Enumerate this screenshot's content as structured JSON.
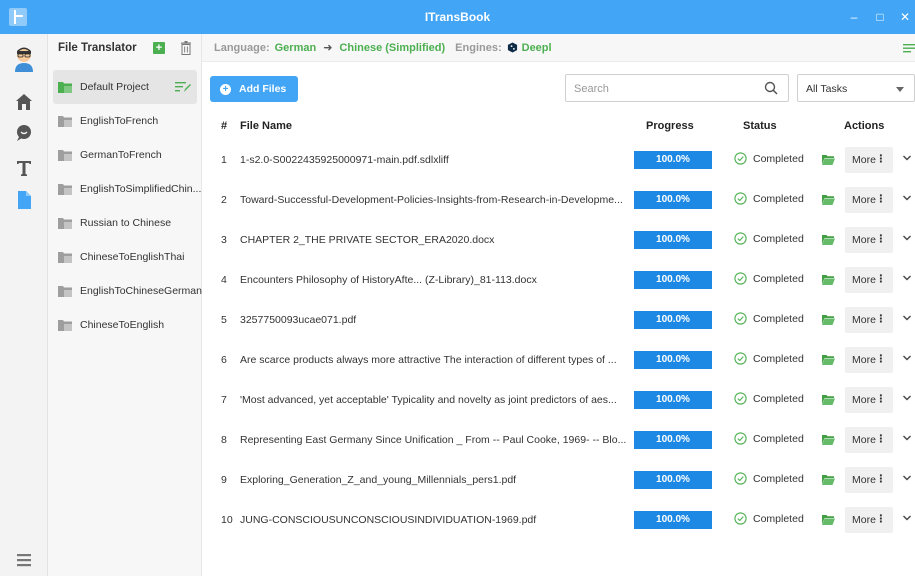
{
  "window": {
    "title": "ITransBook",
    "controls": [
      "minimize",
      "maximize",
      "close"
    ]
  },
  "colors": {
    "accent": "#42a5f5",
    "progress": "#1e88e5",
    "success": "#4caf50"
  },
  "rail": {
    "items": [
      "home-icon",
      "chat-icon",
      "text-icon",
      "file-icon"
    ],
    "active": "file-icon",
    "bottom": "list-icon"
  },
  "sidebar": {
    "title": "File Translator",
    "projects": [
      {
        "label": "Default Project",
        "active": true
      },
      {
        "label": "EnglishToFrench"
      },
      {
        "label": "GermanToFrench"
      },
      {
        "label": "EnglishToSimplifiedChin..."
      },
      {
        "label": "Russian to Chinese"
      },
      {
        "label": "ChineseToEnglishThai"
      },
      {
        "label": "EnglishToChineseGerman"
      },
      {
        "label": "ChineseToEnglish"
      }
    ]
  },
  "langbar": {
    "language_label": "Language:",
    "source": "German",
    "target": "Chinese (Simplified)",
    "engines_label": "Engines:",
    "engine": "Deepl"
  },
  "toolbar": {
    "add_files": "Add Files",
    "search_placeholder": "Search",
    "task_filter": "All Tasks"
  },
  "table": {
    "headers": {
      "num": "#",
      "name": "File Name",
      "progress": "Progress",
      "status": "Status",
      "actions": "Actions"
    },
    "more_label": "More",
    "rows": [
      {
        "num": "1",
        "name": "1-s2.0-S0022435925000971-main.pdf.sdlxliff",
        "progress": "100.0%",
        "progress_value": 1.0,
        "status": "Completed"
      },
      {
        "num": "2",
        "name": "Toward-Successful-Development-Policies-Insights-from-Research-in-Developme...",
        "progress": "100.0%",
        "progress_value": 1.0,
        "status": "Completed"
      },
      {
        "num": "3",
        "name": "CHAPTER 2_THE PRIVATE SECTOR_ERA2020.docx",
        "progress": "100.0%",
        "progress_value": 1.0,
        "status": "Completed"
      },
      {
        "num": "4",
        "name": "Encounters Philosophy of HistoryAfte... (Z-Library)_81-113.docx",
        "progress": "100.0%",
        "progress_value": 1.0,
        "status": "Completed"
      },
      {
        "num": "5",
        "name": "3257750093ucae071.pdf",
        "progress": "100.0%",
        "progress_value": 1.0,
        "status": "Completed"
      },
      {
        "num": "6",
        "name": "Are scarce products always more attractive The interaction of different types of ...",
        "progress": "100.0%",
        "progress_value": 1.0,
        "status": "Completed"
      },
      {
        "num": "7",
        "name": "'Most advanced, yet acceptable' Typicality and novelty as joint predictors of aes...",
        "progress": "100.0%",
        "progress_value": 1.0,
        "status": "Completed"
      },
      {
        "num": "8",
        "name": "Representing East Germany Since Unification _ From -- Paul Cooke, 1969- -- Blo...",
        "progress": "100.0%",
        "progress_value": 1.0,
        "status": "Completed"
      },
      {
        "num": "9",
        "name": "Exploring_Generation_Z_and_young_Millennials_pers1.pdf",
        "progress": "100.0%",
        "progress_value": 1.0,
        "status": "Completed"
      },
      {
        "num": "10",
        "name": "JUNG-CONSCIOUSUNCONSCIOUSINDIVIDUATION-1969.pdf",
        "progress": "100.0%",
        "progress_value": 1.0,
        "status": "Completed"
      }
    ]
  }
}
